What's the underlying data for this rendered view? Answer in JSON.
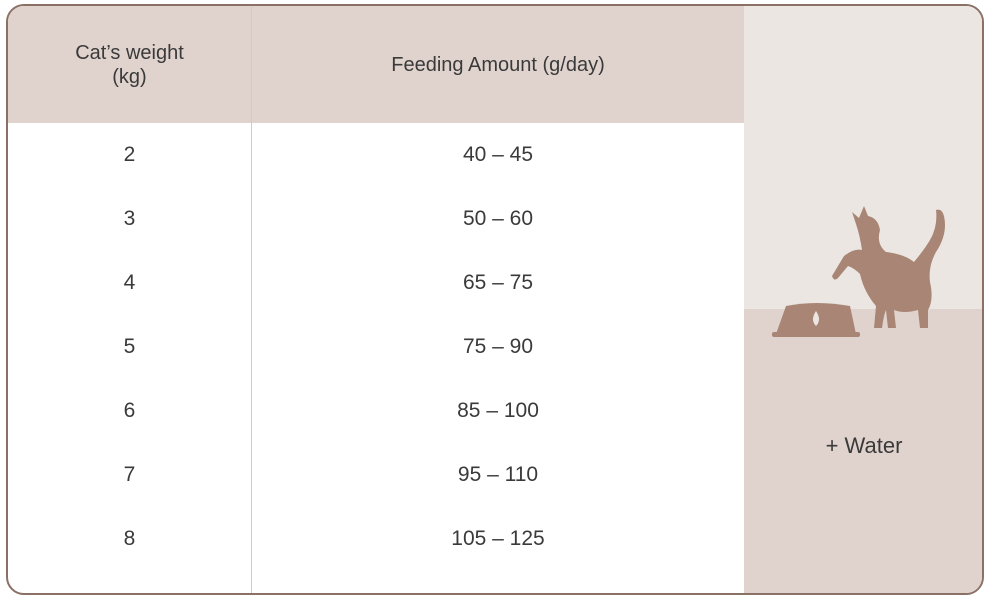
{
  "table": {
    "headers": {
      "weight": "Cat’s weight\n(kg)",
      "amount": "Feeding Amount (g/day)"
    },
    "rows": [
      {
        "weight": "2",
        "amount": "40 – 45"
      },
      {
        "weight": "3",
        "amount": "50 – 60"
      },
      {
        "weight": "4",
        "amount": "65 – 75"
      },
      {
        "weight": "5",
        "amount": "75 – 90"
      },
      {
        "weight": "6",
        "amount": "85 – 100"
      },
      {
        "weight": "7",
        "amount": "95 – 110"
      },
      {
        "weight": "8",
        "amount": "105 – 125"
      }
    ]
  },
  "side_panel": {
    "water_label": "+ Water",
    "illustration": "cat-and-bowl-icon"
  },
  "colors": {
    "header_bg": "#e0d3ce",
    "side_top_bg": "#ece6e3",
    "border": "#8a7065",
    "illustration": "#a88574"
  }
}
